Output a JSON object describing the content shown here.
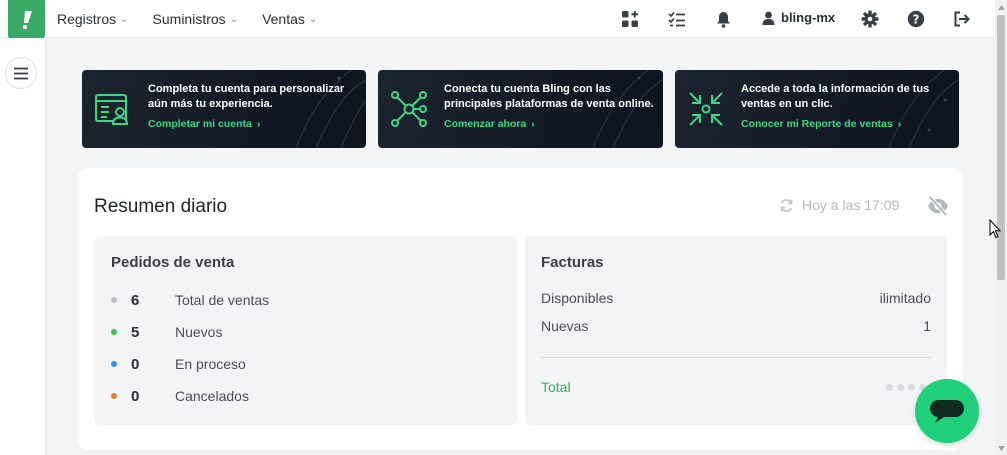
{
  "header": {
    "nav": [
      {
        "label": "Registros"
      },
      {
        "label": "Suministros"
      },
      {
        "label": "Ventas"
      }
    ],
    "user": "bling-mx",
    "icons": [
      "apps-icon",
      "tasks-icon",
      "bell-icon",
      "user-icon",
      "gear-icon",
      "help-icon",
      "logout-icon"
    ]
  },
  "banners": [
    {
      "text": "Completa tu cuenta para personalizar aún más tu experiencia.",
      "link": "Completar mi cuenta",
      "icon": "account-form-icon"
    },
    {
      "text": "Conecta tu cuenta Bling con las principales plataformas de venta online.",
      "link": "Comenzar ahora",
      "icon": "network-icon"
    },
    {
      "text": "Accede a toda la información de tus ventas en un clic.",
      "link": "Conocer mi Reporte de ventas",
      "icon": "collapse-arrows-icon"
    }
  ],
  "summary": {
    "title": "Resumen diario",
    "updated": "Hoy a las 17:09",
    "orders": {
      "title": "Pedidos de venta",
      "rows": [
        {
          "count": "6",
          "label": "Total de ventas",
          "color": "#b9bcc1"
        },
        {
          "count": "5",
          "label": "Nuevos",
          "color": "#43b85c"
        },
        {
          "count": "0",
          "label": "En proceso",
          "color": "#3b8fe0"
        },
        {
          "count": "0",
          "label": "Cancelados",
          "color": "#dd7a3c"
        }
      ]
    },
    "invoices": {
      "title": "Facturas",
      "available_label": "Disponibles",
      "available_value": "ilimitado",
      "new_label": "Nuevas",
      "new_value": "1",
      "total_label": "Total"
    }
  },
  "colors": {
    "brand": "#3aaa66",
    "accent": "#3bd883",
    "chat": "#1fcf7a"
  }
}
